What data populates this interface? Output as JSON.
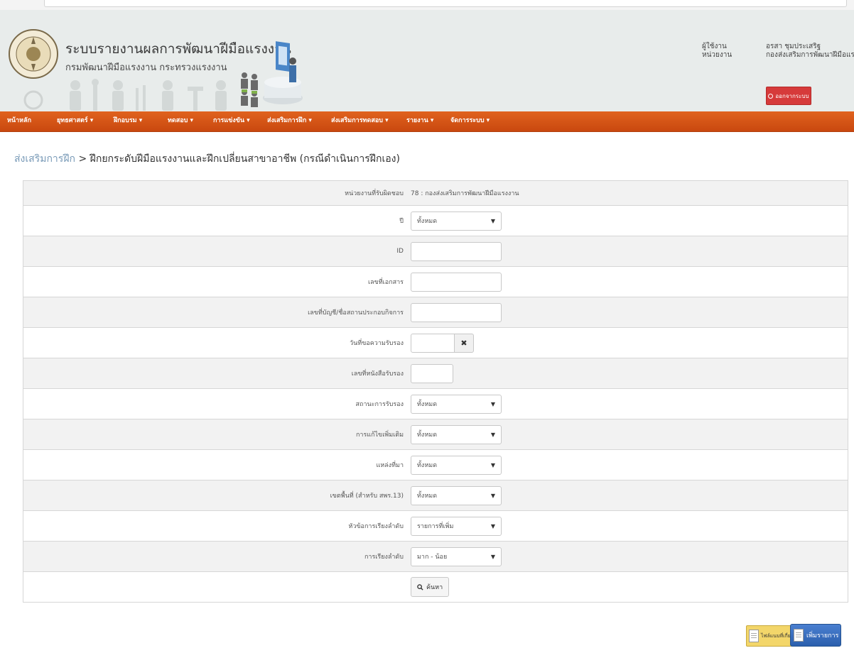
{
  "header": {
    "system_title": "ระบบรายงานผลการพัฒนาฝีมือแรงงาน",
    "department": "กรมพัฒนาฝีมือแรงงาน กระทรวงแรงงาน",
    "user_label": "ผู้ใช้งาน",
    "unit_label": "หน่วยงาน",
    "user_name": "อรสา ชุมประเสริฐ",
    "unit_name": "กองส่งเสริมการพัฒนาฝีมือแรงงาน",
    "logout_label": "ออกจากระบบ"
  },
  "nav": {
    "items": [
      {
        "label": "หน้าหลัก"
      },
      {
        "label": "ยุทธศาสตร์ ▾"
      },
      {
        "label": "ฝึกอบรม ▾"
      },
      {
        "label": "ทดสอบ ▾"
      },
      {
        "label": "การแข่งขัน ▾"
      },
      {
        "label": "ส่งเสริมการฝึก ▾"
      },
      {
        "label": "ส่งเสริมการทดสอบ ▾"
      },
      {
        "label": "รายงาน ▾"
      },
      {
        "label": "จัดการระบบ ▾"
      }
    ]
  },
  "breadcrumb": {
    "parent": "ส่งเสริมการฝึก",
    "separator": ">",
    "current": "ฝึกยกระดับฝีมือแรงงานและฝึกเปลี่ยนสาขาอาชีพ (กรณีดำเนินการฝึกเอง)"
  },
  "form": {
    "agency_label": "หน่วยงานที่รับผิดชอบ",
    "agency_value": "78 : กองส่งเสริมการพัฒนาฝีมือแรงงาน",
    "year_label": "ปี",
    "year_value": "ทั้งหมด",
    "id_label": "ID",
    "id_value": "",
    "docno_label": "เลขที่เอกสาร",
    "docno_value": "",
    "account_label": "เลขที่บัญชี/ชื่อสถานประกอบกิจการ",
    "account_value": "",
    "reqdate_label": "วันที่ขอความรับรอง",
    "reqdate_value": "",
    "certno_label": "เลขที่หนังสือรับรอง",
    "certno_value": "",
    "status_label": "สถานะการรับรอง",
    "status_value": "ทั้งหมด",
    "edit_label": "การแก้ไขเพิ่มเติม",
    "edit_value": "ทั้งหมด",
    "source_label": "แหล่งที่มา",
    "source_value": "ทั้งหมด",
    "zone_label": "เขตพื้นที่ (สำหรับ สพร.13)",
    "zone_value": "ทั้งหมด",
    "sortby_label": "หัวข้อการเรียงลำดับ",
    "sortby_value": "รายการที่เพิ่ม",
    "order_label": "การเรียงลำดับ",
    "order_value": "มาก - น้อย",
    "search_label": "ค้นหา"
  },
  "actions": {
    "attach_label": "ไฟล์แนบที่เกี่ยวข้อง",
    "add_label": "เพิ่มรายการ"
  },
  "colors": {
    "nav_orange": "#d9561a",
    "logout_red": "#d63a3a",
    "add_blue": "#2b5fad"
  }
}
